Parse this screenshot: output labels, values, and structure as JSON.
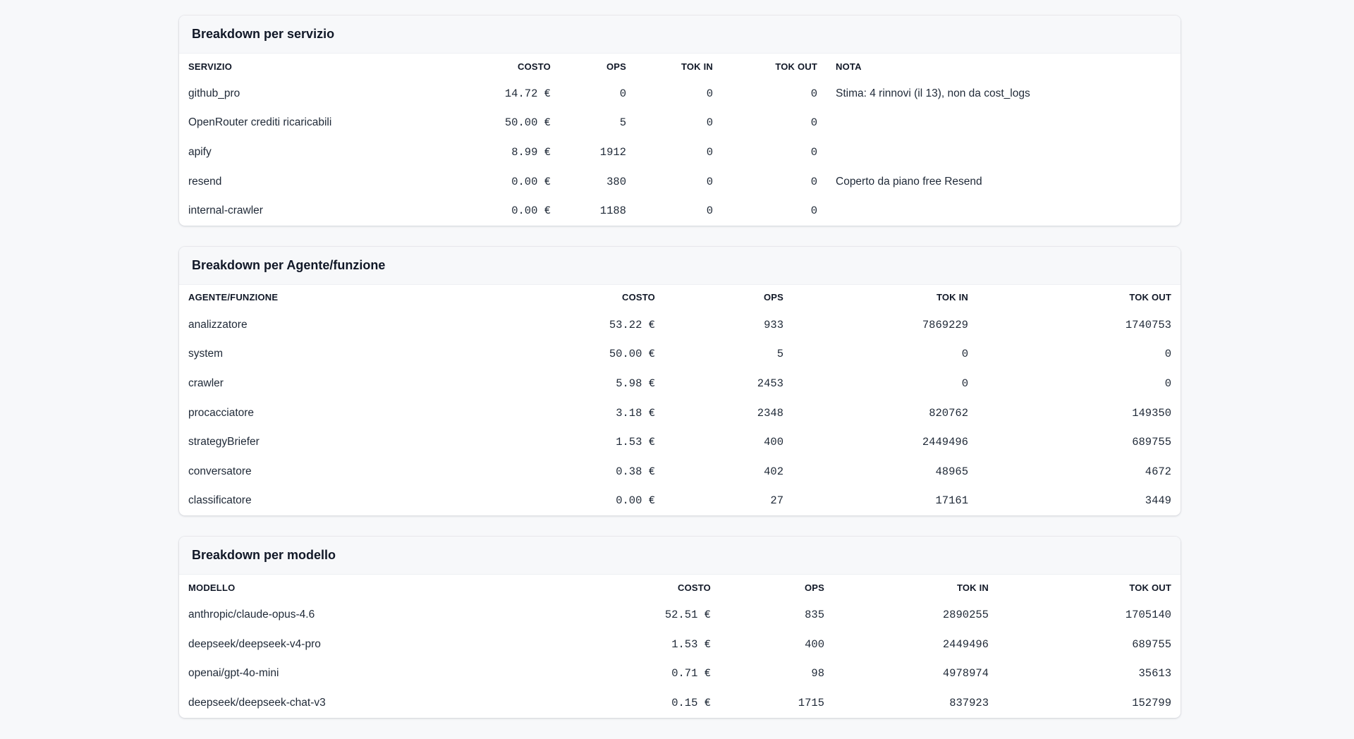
{
  "services": {
    "title": "Breakdown per servizio",
    "headers": [
      "SERVIZIO",
      "COSTO",
      "OPS",
      "TOK IN",
      "TOK OUT",
      "NOTA"
    ],
    "rows": [
      {
        "name": "github_pro",
        "cost": "14.72 €",
        "ops": "0",
        "tok_in": "0",
        "tok_out": "0",
        "note": "Stima: 4 rinnovi (il 13), non da cost_logs"
      },
      {
        "name": "OpenRouter crediti ricaricabili",
        "cost": "50.00 €",
        "ops": "5",
        "tok_in": "0",
        "tok_out": "0",
        "note": ""
      },
      {
        "name": "apify",
        "cost": "8.99 €",
        "ops": "1912",
        "tok_in": "0",
        "tok_out": "0",
        "note": ""
      },
      {
        "name": "resend",
        "cost": "0.00 €",
        "ops": "380",
        "tok_in": "0",
        "tok_out": "0",
        "note": "Coperto da piano free Resend"
      },
      {
        "name": "internal-crawler",
        "cost": "0.00 €",
        "ops": "1188",
        "tok_in": "0",
        "tok_out": "0",
        "note": ""
      }
    ]
  },
  "agents": {
    "title": "Breakdown per Agente/funzione",
    "headers": [
      "AGENTE/FUNZIONE",
      "COSTO",
      "OPS",
      "TOK IN",
      "TOK OUT"
    ],
    "rows": [
      {
        "name": "analizzatore",
        "cost": "53.22 €",
        "ops": "933",
        "tok_in": "7869229",
        "tok_out": "1740753"
      },
      {
        "name": "system",
        "cost": "50.00 €",
        "ops": "5",
        "tok_in": "0",
        "tok_out": "0"
      },
      {
        "name": "crawler",
        "cost": "5.98 €",
        "ops": "2453",
        "tok_in": "0",
        "tok_out": "0"
      },
      {
        "name": "procacciatore",
        "cost": "3.18 €",
        "ops": "2348",
        "tok_in": "820762",
        "tok_out": "149350"
      },
      {
        "name": "strategyBriefer",
        "cost": "1.53 €",
        "ops": "400",
        "tok_in": "2449496",
        "tok_out": "689755"
      },
      {
        "name": "conversatore",
        "cost": "0.38 €",
        "ops": "402",
        "tok_in": "48965",
        "tok_out": "4672"
      },
      {
        "name": "classificatore",
        "cost": "0.00 €",
        "ops": "27",
        "tok_in": "17161",
        "tok_out": "3449"
      }
    ]
  },
  "models": {
    "title": "Breakdown per modello",
    "headers": [
      "MODELLO",
      "COSTO",
      "OPS",
      "TOK IN",
      "TOK OUT"
    ],
    "rows": [
      {
        "name": "anthropic/claude-opus-4.6",
        "cost": "52.51 €",
        "ops": "835",
        "tok_in": "2890255",
        "tok_out": "1705140"
      },
      {
        "name": "deepseek/deepseek-v4-pro",
        "cost": "1.53 €",
        "ops": "400",
        "tok_in": "2449496",
        "tok_out": "689755"
      },
      {
        "name": "openai/gpt-4o-mini",
        "cost": "0.71 €",
        "ops": "98",
        "tok_in": "4978974",
        "tok_out": "35613"
      },
      {
        "name": "deepseek/deepseek-chat-v3",
        "cost": "0.15 €",
        "ops": "1715",
        "tok_in": "837923",
        "tok_out": "152799"
      }
    ]
  }
}
